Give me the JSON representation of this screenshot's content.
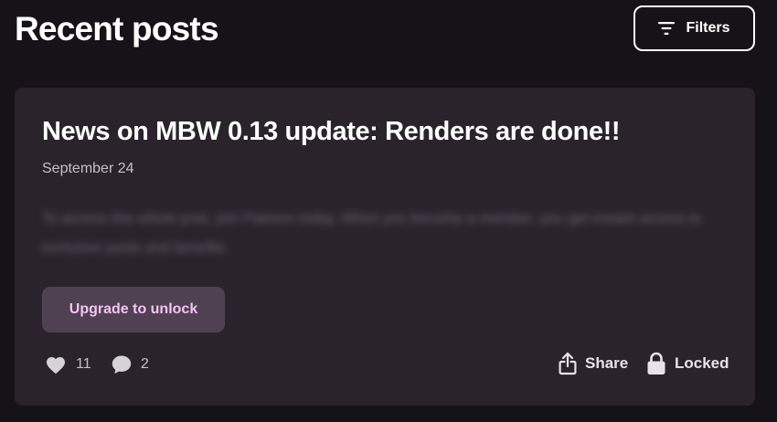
{
  "header": {
    "title": "Recent posts",
    "filters_label": "Filters"
  },
  "post": {
    "title": "News on MBW 0.13 update: Renders are done!!",
    "date": "September 24",
    "teaser": "To access this whole post, join Patreon today. When you become a member, you get instant access to exclusive posts and benefits.",
    "upgrade_label": "Upgrade to unlock",
    "likes_count": "11",
    "comments_count": "2",
    "share_label": "Share",
    "locked_label": "Locked"
  },
  "icons": {
    "filters": "filter-lines-icon",
    "likes": "heart-icon",
    "comments": "speech-bubble-icon",
    "share": "share-up-arrow-icon",
    "locked": "padlock-icon"
  },
  "colors": {
    "background": "#161318",
    "card": "#2a232c",
    "upgrade_button": "#4f4152",
    "upgrade_text": "#f4c3f2",
    "muted_text": "#c6bfc7"
  }
}
